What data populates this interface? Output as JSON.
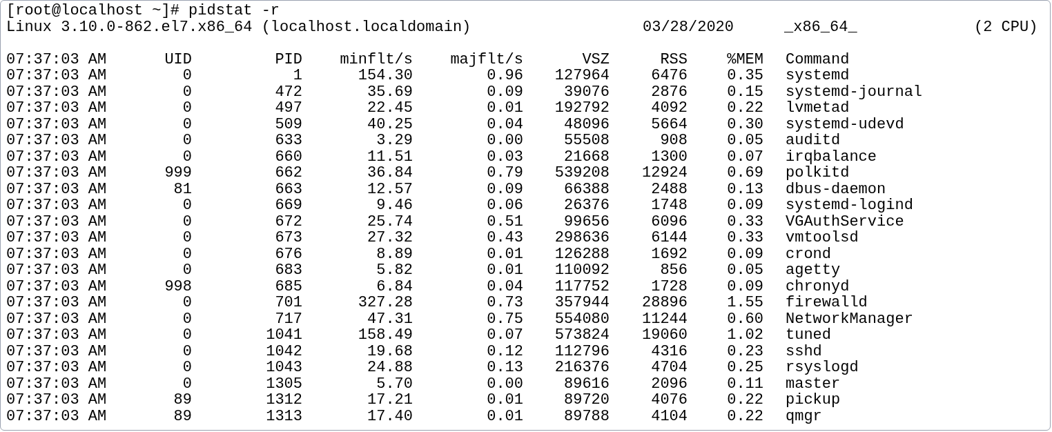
{
  "prompt": "[root@localhost ~]# pidstat -r",
  "system_info": {
    "kernel": "Linux 3.10.0-862.el7.x86_64 (localhost.localdomain)",
    "date": "03/28/2020",
    "arch": "_x86_64_",
    "cpus": "(2 CPU)"
  },
  "table": {
    "columns": [
      "07:37:03 AM",
      "UID",
      "PID",
      "minflt/s",
      "majflt/s",
      "VSZ",
      "RSS",
      "%MEM",
      "Command"
    ],
    "rows": [
      [
        "07:37:03 AM",
        "0",
        "1",
        "154.30",
        "0.96",
        "127964",
        "6476",
        "0.35",
        "systemd"
      ],
      [
        "07:37:03 AM",
        "0",
        "472",
        "35.69",
        "0.09",
        "39076",
        "2876",
        "0.15",
        "systemd-journal"
      ],
      [
        "07:37:03 AM",
        "0",
        "497",
        "22.45",
        "0.01",
        "192792",
        "4092",
        "0.22",
        "lvmetad"
      ],
      [
        "07:37:03 AM",
        "0",
        "509",
        "40.25",
        "0.04",
        "48096",
        "5664",
        "0.30",
        "systemd-udevd"
      ],
      [
        "07:37:03 AM",
        "0",
        "633",
        "3.29",
        "0.00",
        "55508",
        "908",
        "0.05",
        "auditd"
      ],
      [
        "07:37:03 AM",
        "0",
        "660",
        "11.51",
        "0.03",
        "21668",
        "1300",
        "0.07",
        "irqbalance"
      ],
      [
        "07:37:03 AM",
        "999",
        "662",
        "36.84",
        "0.79",
        "539208",
        "12924",
        "0.69",
        "polkitd"
      ],
      [
        "07:37:03 AM",
        "81",
        "663",
        "12.57",
        "0.09",
        "66388",
        "2488",
        "0.13",
        "dbus-daemon"
      ],
      [
        "07:37:03 AM",
        "0",
        "669",
        "9.46",
        "0.06",
        "26376",
        "1748",
        "0.09",
        "systemd-logind"
      ],
      [
        "07:37:03 AM",
        "0",
        "672",
        "25.74",
        "0.51",
        "99656",
        "6096",
        "0.33",
        "VGAuthService"
      ],
      [
        "07:37:03 AM",
        "0",
        "673",
        "27.32",
        "0.43",
        "298636",
        "6144",
        "0.33",
        "vmtoolsd"
      ],
      [
        "07:37:03 AM",
        "0",
        "676",
        "8.89",
        "0.01",
        "126288",
        "1692",
        "0.09",
        "crond"
      ],
      [
        "07:37:03 AM",
        "0",
        "683",
        "5.82",
        "0.01",
        "110092",
        "856",
        "0.05",
        "agetty"
      ],
      [
        "07:37:03 AM",
        "998",
        "685",
        "6.84",
        "0.04",
        "117752",
        "1728",
        "0.09",
        "chronyd"
      ],
      [
        "07:37:03 AM",
        "0",
        "701",
        "327.28",
        "0.73",
        "357944",
        "28896",
        "1.55",
        "firewalld"
      ],
      [
        "07:37:03 AM",
        "0",
        "717",
        "47.31",
        "0.75",
        "554080",
        "11244",
        "0.60",
        "NetworkManager"
      ],
      [
        "07:37:03 AM",
        "0",
        "1041",
        "158.49",
        "0.07",
        "573824",
        "19060",
        "1.02",
        "tuned"
      ],
      [
        "07:37:03 AM",
        "0",
        "1042",
        "19.68",
        "0.12",
        "112796",
        "4316",
        "0.23",
        "sshd"
      ],
      [
        "07:37:03 AM",
        "0",
        "1043",
        "24.88",
        "0.13",
        "216376",
        "4704",
        "0.25",
        "rsyslogd"
      ],
      [
        "07:37:03 AM",
        "0",
        "1305",
        "5.70",
        "0.00",
        "89616",
        "2096",
        "0.11",
        "master"
      ],
      [
        "07:37:03 AM",
        "89",
        "1312",
        "17.21",
        "0.01",
        "89720",
        "4076",
        "0.22",
        "pickup"
      ],
      [
        "07:37:03 AM",
        "89",
        "1313",
        "17.40",
        "0.01",
        "89788",
        "4104",
        "0.22",
        "qmgr"
      ]
    ]
  }
}
